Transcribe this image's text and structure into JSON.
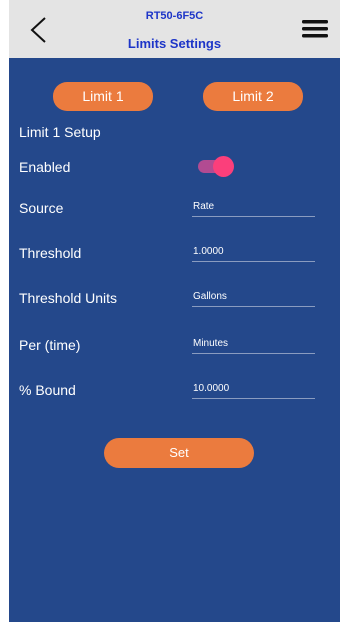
{
  "header": {
    "device_name": "RT50-6F5C",
    "title": "Limits Settings",
    "back_icon": "back-chevron-icon",
    "menu_icon": "hamburger-menu-icon"
  },
  "tabs": [
    {
      "label": "Limit 1",
      "selected": true
    },
    {
      "label": "Limit 2",
      "selected": false
    }
  ],
  "setup": {
    "section_title": "Limit 1 Setup",
    "enabled": {
      "label": "Enabled",
      "on": true
    },
    "fields": [
      {
        "label": "Source",
        "value": "Rate"
      },
      {
        "label": "Threshold",
        "value": "1.0000"
      },
      {
        "label": "Threshold Units",
        "value": "Gallons"
      },
      {
        "label": "Per (time)",
        "value": "Minutes"
      },
      {
        "label": "% Bound",
        "value": "10.0000"
      }
    ]
  },
  "set_button_label": "Set",
  "colors": {
    "header_bg": "#e4e4e4",
    "header_text": "#1d35c8",
    "content_bg": "#24488b",
    "accent": "#eb7b3e",
    "toggle_on": "#fb3f7b"
  }
}
